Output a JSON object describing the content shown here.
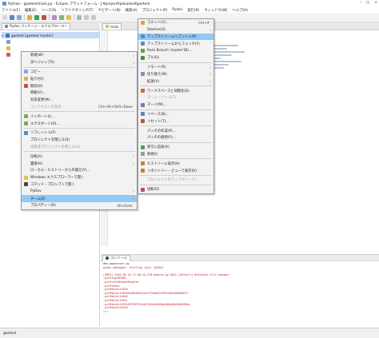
{
  "window": {
    "title": "Python - gaetest/main.py - Eclipse プラットフォーム - J:¥project¥pleiades¥gaetest"
  },
  "menubar": [
    "ファイル(F)",
    "編集(E)",
    "ソース(S)",
    "リファクタリング(T)",
    "ナビゲート(N)",
    "検索(A)",
    "プロジェクト(P)",
    "Pydev",
    "実行(R)",
    "ウィンドウ(W)",
    "ヘルプ(H)"
  ],
  "explorer_tab": {
    "label": "Pydev パッケージ・エクスプローラー"
  },
  "editor_tab": {
    "label": "main"
  },
  "tree": [
    {
      "label": "gaetest [gaetest master]",
      "selected": true
    },
    {
      "label": ""
    },
    {
      "label": ""
    },
    {
      "label": ""
    }
  ],
  "context_menu": [
    {
      "label": "新規(W)",
      "arrow": true
    },
    {
      "label": "次へジャンプ(I)",
      "arrow": true
    },
    {
      "sep": true
    },
    {
      "label": "コピー",
      "icon": "copy-icon"
    },
    {
      "label": "貼り付け",
      "icon": "paste-icon"
    },
    {
      "label": "削除(D)",
      "icon": "delete-icon"
    },
    {
      "label": "移動(V)..."
    },
    {
      "label": "名前変更(M)..."
    },
    {
      "label": "コンテキストを除去",
      "disabled": true,
      "shortcut": "Ctrl+Alt+Shift+Down"
    },
    {
      "sep": true
    },
    {
      "label": "インポート(I)...",
      "icon": "import-icon"
    },
    {
      "label": "エクスポート(O)...",
      "icon": "export-icon"
    },
    {
      "sep": true
    },
    {
      "label": "リフレッシュ(F)",
      "icon": "refresh-icon"
    },
    {
      "label": "プロジェクトを閉じる(S)"
    },
    {
      "label": "未関連プロジェクトを閉じる(U)",
      "disabled": true
    },
    {
      "sep": true
    },
    {
      "label": "比較(A)",
      "arrow": true
    },
    {
      "label": "置換(H)",
      "arrow": true
    },
    {
      "label": "ローカル・ヒストリーからの復元(Y)..."
    },
    {
      "label": "Windows エクスプローラーで開く",
      "icon": "folder-icon"
    },
    {
      "label": "コマンド・プロンプトで開く",
      "icon": "console-icon"
    },
    {
      "label": "PyDev",
      "arrow": true
    },
    {
      "label": "チーム(E)",
      "arrow": true,
      "highlighted": true
    },
    {
      "label": "プロパティー(R)",
      "shortcut": "Alt+Enter"
    }
  ],
  "team_menu": [
    {
      "label": "コミット(C)...",
      "icon": "commit-icon",
      "shortcut": "Ctrl+#"
    },
    {
      "label": "Stashes(S)",
      "arrow": true
    },
    {
      "label": "アップストリームへプッシュ(P)",
      "icon": "push-icon",
      "highlighted": true
    },
    {
      "label": "アップストリームからフェッチ(F)",
      "icon": "fetch-icon"
    },
    {
      "label": "Push Branch 'master'(B)...",
      "icon": "push-branch-icon"
    },
    {
      "label": "プル(U)",
      "icon": "pull-icon"
    },
    {
      "sep": true
    },
    {
      "label": "リモート(R)",
      "arrow": true
    },
    {
      "label": "切り替え(W)",
      "arrow": true,
      "icon": "switch-icon"
    },
    {
      "label": "拡張(V)",
      "arrow": true
    },
    {
      "sep": true
    },
    {
      "label": "ワークスペースと同期化(S)",
      "icon": "sync-icon"
    },
    {
      "label": "マージ・ツール(T)",
      "disabled": true
    },
    {
      "label": "マージ(M)...",
      "icon": "merge-icon"
    },
    {
      "sep": true
    },
    {
      "label": "リベース(B)...",
      "icon": "rebase-icon"
    },
    {
      "label": "リセット(T)...",
      "icon": "reset-icon"
    },
    {
      "sep": true
    },
    {
      "label": "パッチの作成(P)..."
    },
    {
      "label": "パッチの適用(Y)..."
    },
    {
      "sep": true
    },
    {
      "label": "索引に追加(A)",
      "icon": "add-index-icon"
    },
    {
      "label": "無視(I)",
      "icon": "ignore-icon"
    },
    {
      "sep": true
    },
    {
      "label": "ヒストリーに表示(H)",
      "icon": "history-icon"
    },
    {
      "label": "リポジトリー・ビューで表示(R)",
      "icon": "repo-icon"
    },
    {
      "sep": true
    },
    {
      "label": "プロジェクトのアップグレード...",
      "disabled": true
    },
    {
      "sep": true
    },
    {
      "label": "切断(D)",
      "icon": "disconnect-icon"
    }
  ],
  "console": {
    "tab_label": "コンソール",
    "header": "dev_appserver.py",
    "lines": [
      {
        "text": "pydev debugger: starting (pid: 10456)",
        "color": "red"
      },
      {
        "text": "",
        "color": "blk"
      },
      {
        "text": "[INFO]    2016-06-10 17:50:15,278 module.py:402] [default] Detected file changes:",
        "color": "red"
      },
      {
        "text": "  .git¥logs¥HEAD",
        "color": "red"
      },
      {
        "text": "  .git¥refs¥heads¥master",
        "color": "red"
      },
      {
        "text": "  .git¥index",
        "color": "red"
      },
      {
        "text": "  .git¥objects¥2d",
        "color": "red"
      },
      {
        "text": "  .git¥objects¥d4¥aa6ed55afe21f7eedb74f8e7baec668e007f",
        "color": "red"
      },
      {
        "text": "  .git¥objects¥d4",
        "color": "red"
      },
      {
        "text": "  .git¥objects¥2c",
        "color": "red"
      },
      {
        "text": "  .git¥objects¥2c¥4f9879fe1b2fb5da1b30ae000a6ba5e00304a",
        "color": "red"
      },
      {
        "text": "  .git¥objects¥2d",
        "color": "red"
      },
      {
        "text": ">>>",
        "color": "grn"
      }
    ]
  },
  "status": {
    "text": "gaetest"
  },
  "colors": {
    "highlight": "#91c9f7",
    "menu_bg": "#f2f2f2",
    "console_red": "#c8232c"
  }
}
